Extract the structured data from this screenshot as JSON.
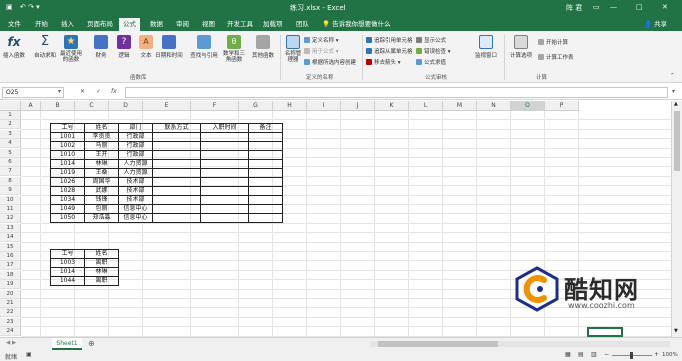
{
  "title": {
    "quick_access": "↶ ↷ ▾",
    "filename": "练习.xlsx - Excel",
    "user": "阵 君",
    "minimize": "—",
    "restore": "□",
    "close": "✕"
  },
  "tabs": [
    {
      "label": "文件"
    },
    {
      "label": "开始"
    },
    {
      "label": "插入"
    },
    {
      "label": "页面布局"
    },
    {
      "label": "公式",
      "active": true
    },
    {
      "label": "数据"
    },
    {
      "label": "审阅"
    },
    {
      "label": "视图"
    },
    {
      "label": "开发工具"
    },
    {
      "label": "加载项"
    },
    {
      "label": "团队"
    }
  ],
  "tell_me": "告诉我你想要做什么",
  "share": "共享",
  "ribbon": {
    "insert_function": "插入函数",
    "autosum": "自动求和",
    "recent": "最近使用的函数",
    "financial": "财务",
    "logical": "逻辑",
    "text": "文本",
    "datetime": "日期和时间",
    "lookup": "查找与引用",
    "math": "数学和三角函数",
    "more": "其他函数",
    "group_library": "函数库",
    "name_manager": "名称管理器",
    "define_name": "定义名称 ▾",
    "use_in_formula": "用于公式 ▾",
    "create_from_selection": "根据所选内容创建",
    "group_names": "定义的名称",
    "trace_precedents": "追踪引用单元格",
    "trace_dependents": "追踪从属单元格",
    "remove_arrows": "移去箭头 ▾",
    "show_formulas": "显示公式",
    "error_checking": "错误检查 ▾",
    "evaluate": "公式求值",
    "group_audit": "公式审核",
    "watch": "监视窗口",
    "calc_options": "计算选项",
    "calc_now": "开始计算",
    "calc_sheet": "计算工作表",
    "group_calc": "计算"
  },
  "namebox": "O25",
  "formula_icons": {
    "cancel": "✕",
    "enter": "✓",
    "fx": "fx"
  },
  "columns": [
    "A",
    "B",
    "C",
    "D",
    "E",
    "F",
    "G",
    "H",
    "I",
    "J",
    "K",
    "L",
    "M",
    "N",
    "O",
    "P"
  ],
  "selected_column": "O",
  "rows": [
    "1",
    "2",
    "3",
    "4",
    "5",
    "6",
    "7",
    "8",
    "9",
    "10",
    "11",
    "12",
    "13",
    "14",
    "15",
    "16",
    "17",
    "18",
    "19",
    "20",
    "21",
    "22",
    "23",
    "24"
  ],
  "table1": {
    "headers": [
      "工号",
      "姓名",
      "部门",
      "联系方式",
      "入职时间",
      "备注"
    ],
    "rows": [
      [
        "1001",
        "李贡贡",
        "行政部",
        "",
        "",
        ""
      ],
      [
        "1002",
        "马丽",
        "行政部",
        "",
        "",
        ""
      ],
      [
        "1010",
        "王开",
        "行政部",
        "",
        "",
        ""
      ],
      [
        "1014",
        "林琳",
        "人力资源",
        "",
        "",
        ""
      ],
      [
        "1019",
        "王桑",
        "人力资源",
        "",
        "",
        ""
      ],
      [
        "1026",
        "周国华",
        "技术部",
        "",
        "",
        ""
      ],
      [
        "1028",
        "武娜",
        "技术部",
        "",
        "",
        ""
      ],
      [
        "1034",
        "钱锋",
        "技术部",
        "",
        "",
        ""
      ],
      [
        "1049",
        "包丽",
        "信息中心",
        "",
        "",
        ""
      ],
      [
        "1050",
        "郑浩淼",
        "信息中心",
        "",
        "",
        ""
      ]
    ]
  },
  "table2": {
    "headers": [
      "工号",
      "姓名"
    ],
    "rows": [
      [
        "1003",
        "离职"
      ],
      [
        "1014",
        "林琳"
      ],
      [
        "1044",
        "离职"
      ]
    ]
  },
  "sheet": {
    "tab": "Sheet1",
    "add": "⊕",
    "nav": "◀ ▶"
  },
  "status": {
    "ready": "就绪",
    "zoom": "100%",
    "zoom_minus": "−",
    "zoom_plus": "+"
  },
  "watermark": {
    "brand": "酷知网",
    "url": "www.coozhi.com"
  },
  "colors": {
    "excel_green": "#217346",
    "border": "#222222",
    "logo_orange": "#f29100",
    "logo_blue": "#1d2d8f"
  }
}
